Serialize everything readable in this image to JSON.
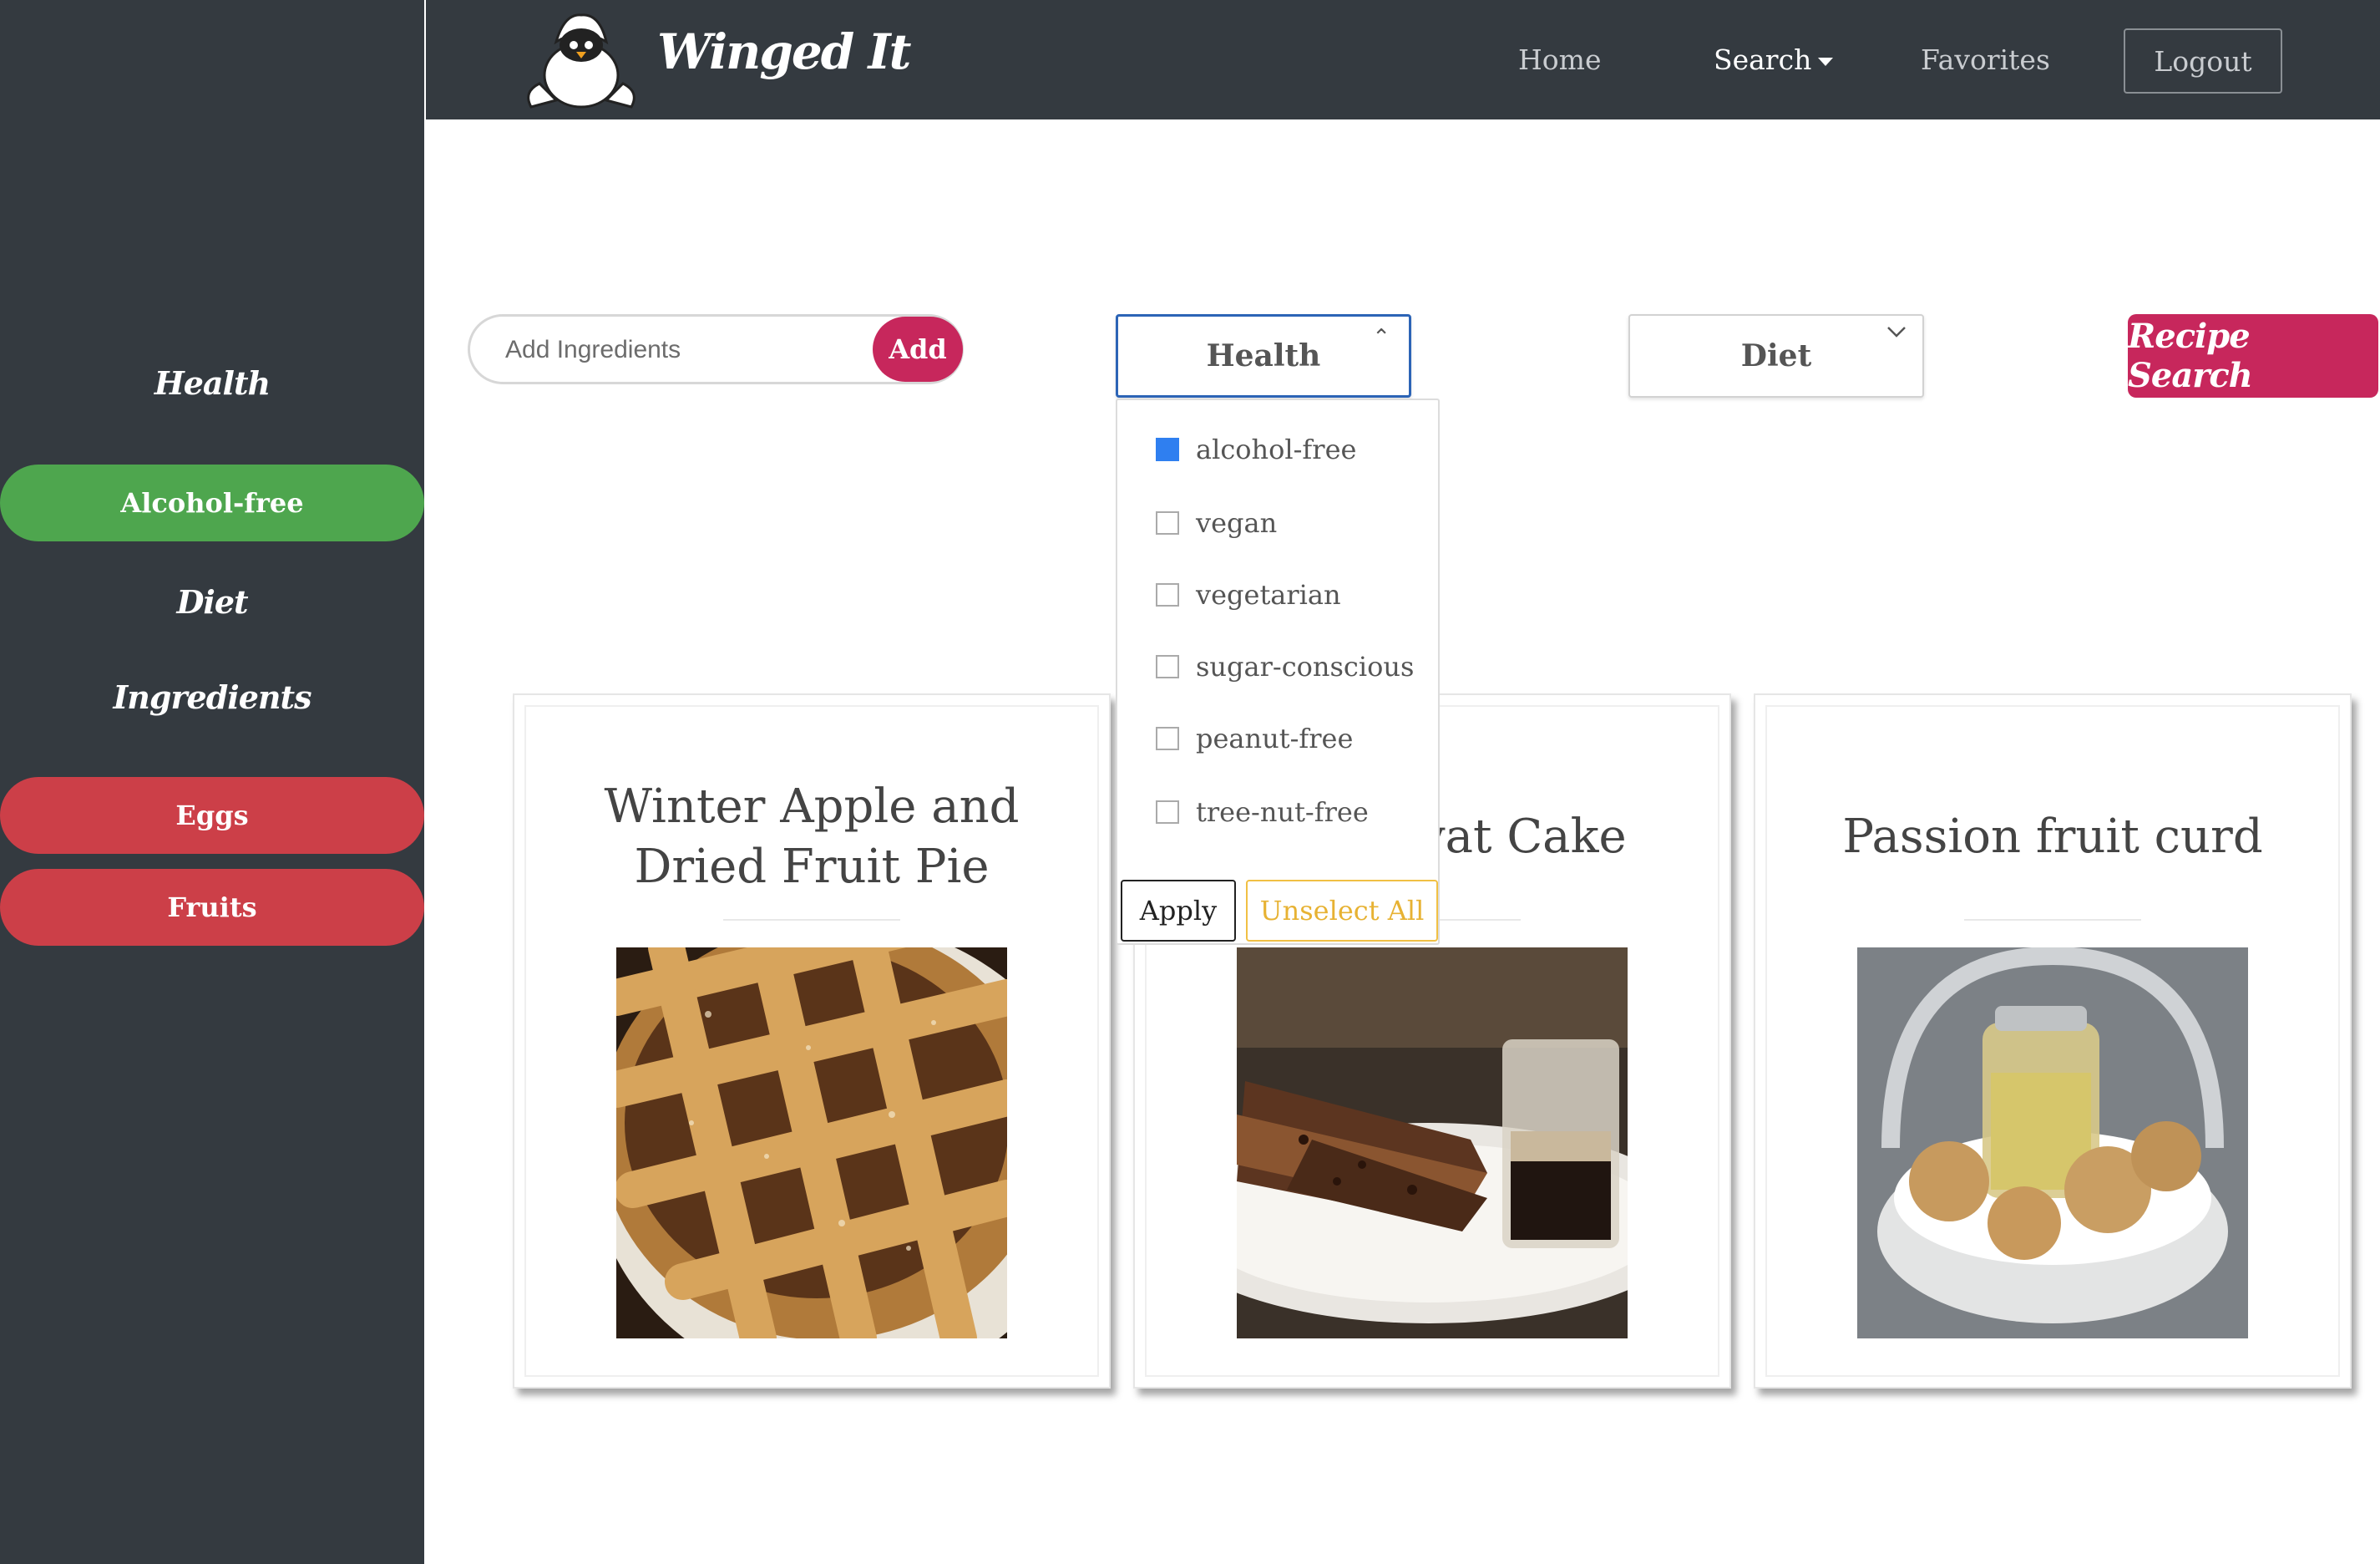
{
  "sidebar": {
    "health_heading": "Health",
    "health_tags": [
      "Alcohol-free"
    ],
    "diet_heading": "Diet",
    "ingredients_heading": "Ingredients",
    "ingredient_tags": [
      "Eggs",
      "Fruits"
    ]
  },
  "navbar": {
    "brand": "Winged It",
    "links": {
      "home": "Home",
      "search": "Search",
      "favorites": "Favorites"
    },
    "logout": "Logout"
  },
  "search": {
    "ingredients_placeholder": "Add Ingredients",
    "add_label": "Add",
    "health_label": "Health",
    "diet_label": "Diet",
    "recipe_search_label": "Recipe Search"
  },
  "health_dropdown": {
    "options": [
      {
        "label": "alcohol-free",
        "checked": true
      },
      {
        "label": "vegan",
        "checked": false
      },
      {
        "label": "vegetarian",
        "checked": false
      },
      {
        "label": "sugar-conscious",
        "checked": false
      },
      {
        "label": "peanut-free",
        "checked": false
      },
      {
        "label": "tree-nut-free",
        "checked": false
      }
    ],
    "apply_label": "Apply",
    "unselect_label": "Unselect All"
  },
  "recipes": [
    {
      "title": "Winter Apple and Dried Fruit Pie"
    },
    {
      "title": "vat Cake"
    },
    {
      "title": "Passion fruit curd"
    }
  ],
  "colors": {
    "sidebar_bg": "#343a40",
    "health_tag": "#4ea64e",
    "ingredient_tag": "#cc3f48",
    "accent": "#c7275c",
    "checkbox_on": "#2f7ff0",
    "unselect": "#f1c044"
  }
}
